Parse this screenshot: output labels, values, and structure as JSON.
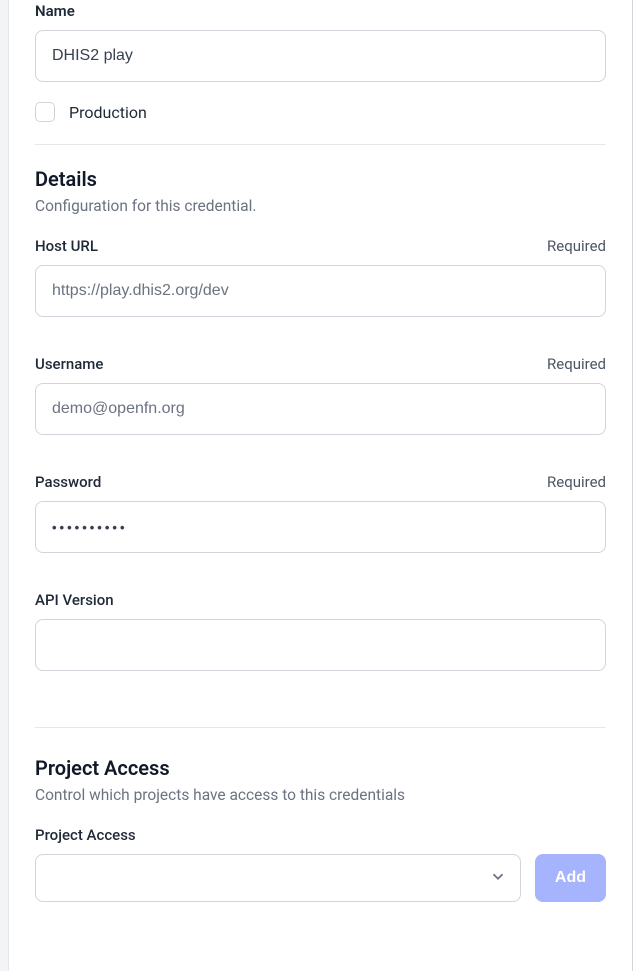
{
  "name": {
    "label": "Name",
    "value": "DHIS2 play"
  },
  "production": {
    "label": "Production"
  },
  "details": {
    "title": "Details",
    "subtitle": "Configuration for this credential.",
    "required_text": "Required",
    "host_url": {
      "label": "Host URL",
      "value": "https://play.dhis2.org/dev"
    },
    "username": {
      "label": "Username",
      "value": "demo@openfn.org"
    },
    "password": {
      "label": "Password",
      "value": "••••••••••"
    },
    "api_version": {
      "label": "API Version",
      "value": ""
    }
  },
  "project_access": {
    "title": "Project Access",
    "subtitle": "Control which projects have access to this credentials",
    "label": "Project Access",
    "add_button": "Add"
  }
}
